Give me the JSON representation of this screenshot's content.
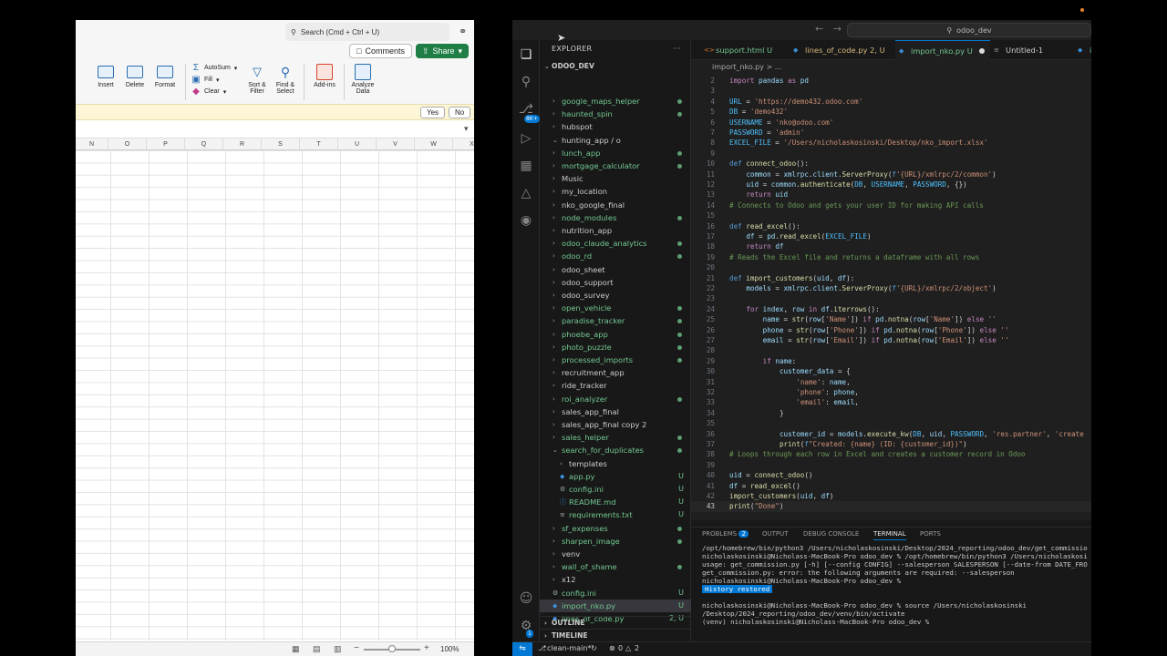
{
  "excel": {
    "search": "Search (Cmd + Ctrl + U)",
    "comments": "Comments",
    "share": "Share",
    "ribbon": {
      "insert": "Insert",
      "delete": "Delete",
      "format": "Format",
      "autosum": "AutoSum",
      "fill": "Fill",
      "clear": "Clear",
      "sort1": "Sort &",
      "sort2": "Filter",
      "find1": "Find &",
      "find2": "Select",
      "addins": "Add-ins",
      "analyze1": "Analyze",
      "analyze2": "Data"
    },
    "banner": {
      "yes": "Yes",
      "no": "No"
    },
    "columns": [
      "N",
      "O",
      "P",
      "Q",
      "R",
      "S",
      "T",
      "U",
      "V",
      "W",
      "X"
    ],
    "zoom": "100%"
  },
  "vscode": {
    "command_center": "odoo_dev",
    "explorer_title": "EXPLORER",
    "root_folder": "ODOO_DEV",
    "scm_badge": "8K+",
    "settings_badge": "1",
    "tree": [
      {
        "label": "google_maps_helper",
        "stat": "dot",
        "color": "#73c991",
        "depth": 1,
        "type": "folder"
      },
      {
        "label": "haunted_spin",
        "stat": "dot",
        "color": "#73c991",
        "depth": 1,
        "type": "folder"
      },
      {
        "label": "hubspot",
        "stat": "",
        "color": "#cccccc",
        "depth": 1,
        "type": "folder"
      },
      {
        "label": "hunting_app / o",
        "stat": "",
        "color": "#cccccc",
        "depth": 1,
        "type": "open"
      },
      {
        "label": "lunch_app",
        "stat": "dot",
        "color": "#73c991",
        "depth": 1,
        "type": "folder"
      },
      {
        "label": "mortgage_calculator",
        "stat": "dot",
        "color": "#73c991",
        "depth": 1,
        "type": "folder"
      },
      {
        "label": "Music",
        "stat": "",
        "color": "#cccccc",
        "depth": 1,
        "type": "folder"
      },
      {
        "label": "my_location",
        "stat": "",
        "color": "#cccccc",
        "depth": 1,
        "type": "folder"
      },
      {
        "label": "nko_google_final",
        "stat": "",
        "color": "#cccccc",
        "depth": 1,
        "type": "folder"
      },
      {
        "label": "node_modules",
        "stat": "dot",
        "color": "#73c991",
        "depth": 1,
        "type": "folder"
      },
      {
        "label": "nutrition_app",
        "stat": "",
        "color": "#cccccc",
        "depth": 1,
        "type": "folder"
      },
      {
        "label": "odoo_claude_analytics",
        "stat": "dot",
        "color": "#73c991",
        "depth": 1,
        "type": "folder"
      },
      {
        "label": "odoo_rd",
        "stat": "dot",
        "color": "#73c991",
        "depth": 1,
        "type": "folder"
      },
      {
        "label": "odoo_sheet",
        "stat": "",
        "color": "#cccccc",
        "depth": 1,
        "type": "folder"
      },
      {
        "label": "odoo_support",
        "stat": "",
        "color": "#cccccc",
        "depth": 1,
        "type": "folder"
      },
      {
        "label": "odoo_survey",
        "stat": "",
        "color": "#cccccc",
        "depth": 1,
        "type": "folder"
      },
      {
        "label": "open_vehicle",
        "stat": "dot",
        "color": "#73c991",
        "depth": 1,
        "type": "folder"
      },
      {
        "label": "paradise_tracker",
        "stat": "dot",
        "color": "#73c991",
        "depth": 1,
        "type": "folder"
      },
      {
        "label": "phoebe_app",
        "stat": "dot",
        "color": "#73c991",
        "depth": 1,
        "type": "folder"
      },
      {
        "label": "photo_puzzle",
        "stat": "dot",
        "color": "#73c991",
        "depth": 1,
        "type": "folder"
      },
      {
        "label": "processed_imports",
        "stat": "dot",
        "color": "#73c991",
        "depth": 1,
        "type": "folder"
      },
      {
        "label": "recruitment_app",
        "stat": "",
        "color": "#cccccc",
        "depth": 1,
        "type": "folder"
      },
      {
        "label": "ride_tracker",
        "stat": "",
        "color": "#cccccc",
        "depth": 1,
        "type": "folder"
      },
      {
        "label": "roi_analyzer",
        "stat": "dot",
        "color": "#73c991",
        "depth": 1,
        "type": "folder"
      },
      {
        "label": "sales_app_final",
        "stat": "",
        "color": "#cccccc",
        "depth": 1,
        "type": "folder"
      },
      {
        "label": "sales_app_final copy 2",
        "stat": "",
        "color": "#cccccc",
        "depth": 1,
        "type": "folder"
      },
      {
        "label": "sales_helper",
        "stat": "dot",
        "color": "#73c991",
        "depth": 1,
        "type": "folder"
      },
      {
        "label": "search_for_duplicates",
        "stat": "dot",
        "color": "#73c991",
        "depth": 1,
        "type": "open"
      },
      {
        "label": "templates",
        "stat": "",
        "color": "#cccccc",
        "depth": 2,
        "type": "folder"
      },
      {
        "label": "app.py",
        "stat": "U",
        "color": "#73c991",
        "depth": 2,
        "type": "py"
      },
      {
        "label": "config.ini",
        "stat": "U",
        "color": "#73c991",
        "depth": 2,
        "type": "ini"
      },
      {
        "label": "README.md",
        "stat": "U",
        "color": "#73c991",
        "depth": 2,
        "type": "info"
      },
      {
        "label": "requirements.txt",
        "stat": "U",
        "color": "#73c991",
        "depth": 2,
        "type": "txt"
      },
      {
        "label": "sf_expenses",
        "stat": "dot",
        "color": "#73c991",
        "depth": 1,
        "type": "folder"
      },
      {
        "label": "sharpen_image",
        "stat": "dot",
        "color": "#73c991",
        "depth": 1,
        "type": "folder"
      },
      {
        "label": "venv",
        "stat": "",
        "color": "#cccccc",
        "depth": 1,
        "type": "folder"
      },
      {
        "label": "wall_of_shame",
        "stat": "dot",
        "color": "#73c991",
        "depth": 1,
        "type": "folder"
      },
      {
        "label": "x12",
        "stat": "",
        "color": "#cccccc",
        "depth": 1,
        "type": "folder"
      },
      {
        "label": "config.ini",
        "stat": "U",
        "color": "#73c991",
        "depth": 0,
        "type": "ini"
      },
      {
        "label": "import_nko.py",
        "stat": "U",
        "color": "#73c991",
        "depth": 0,
        "type": "py",
        "selected": true
      },
      {
        "label": "lines_of_code.py",
        "stat": "2, U",
        "color": "#73c991",
        "depth": 0,
        "type": "py"
      }
    ],
    "outline": "OUTLINE",
    "timeline": "TIMELINE",
    "tabs": [
      {
        "label": "support.html U",
        "icon": "<>",
        "color": "#73c991",
        "active": false
      },
      {
        "label": "lines_of_code.py 2, U",
        "icon": "py",
        "color": "#d7ba7d",
        "active": false
      },
      {
        "label": "import_nko.py U",
        "icon": "py",
        "color": "#73c991",
        "active": true
      },
      {
        "label": "Untitled-1",
        "icon": "=",
        "color": "#cccccc",
        "active": false
      },
      {
        "label": "i",
        "icon": "py",
        "color": "#73c991",
        "active": false
      }
    ],
    "breadcrumb": "import_nko.py > ...",
    "code": [
      {
        "n": "2",
        "t": "import pandas as pd"
      },
      {
        "n": "3",
        "t": ""
      },
      {
        "n": "4",
        "t": "URL = 'https://demo432.odoo.com'"
      },
      {
        "n": "5",
        "t": "DB = 'demo432'"
      },
      {
        "n": "6",
        "t": "USERNAME = 'nko@odoo.com'"
      },
      {
        "n": "7",
        "t": "PASSWORD = 'admin'"
      },
      {
        "n": "8",
        "t": "EXCEL_FILE = '/Users/nicholaskosinski/Desktop/nko_import.xlsx'"
      },
      {
        "n": "9",
        "t": ""
      },
      {
        "n": "10",
        "t": "def connect_odoo():"
      },
      {
        "n": "11",
        "t": "    common = xmlrpc.client.ServerProxy(f'{URL}/xmlrpc/2/common')"
      },
      {
        "n": "12",
        "t": "    uid = common.authenticate(DB, USERNAME, PASSWORD, {})"
      },
      {
        "n": "13",
        "t": "    return uid"
      },
      {
        "n": "14",
        "t": "# Connects to Odoo and gets your user ID for making API calls"
      },
      {
        "n": "15",
        "t": ""
      },
      {
        "n": "16",
        "t": "def read_excel():"
      },
      {
        "n": "17",
        "t": "    df = pd.read_excel(EXCEL_FILE)"
      },
      {
        "n": "18",
        "t": "    return df"
      },
      {
        "n": "19",
        "t": "# Reads the Excel file and returns a dataframe with all rows"
      },
      {
        "n": "20",
        "t": ""
      },
      {
        "n": "21",
        "t": "def import_customers(uid, df):"
      },
      {
        "n": "22",
        "t": "    models = xmlrpc.client.ServerProxy(f'{URL}/xmlrpc/2/object')"
      },
      {
        "n": "23",
        "t": ""
      },
      {
        "n": "24",
        "t": "    for index, row in df.iterrows():"
      },
      {
        "n": "25",
        "t": "        name = str(row['Name']) if pd.notna(row['Name']) else ''"
      },
      {
        "n": "26",
        "t": "        phone = str(row['Phone']) if pd.notna(row['Phone']) else ''"
      },
      {
        "n": "27",
        "t": "        email = str(row['Email']) if pd.notna(row['Email']) else ''"
      },
      {
        "n": "28",
        "t": ""
      },
      {
        "n": "29",
        "t": "        if name:"
      },
      {
        "n": "30",
        "t": "            customer_data = {"
      },
      {
        "n": "31",
        "t": "                'name': name,"
      },
      {
        "n": "32",
        "t": "                'phone': phone,"
      },
      {
        "n": "33",
        "t": "                'email': email,"
      },
      {
        "n": "34",
        "t": "            }"
      },
      {
        "n": "35",
        "t": ""
      },
      {
        "n": "36",
        "t": "            customer_id = models.execute_kw(DB, uid, PASSWORD, 'res.partner', 'create"
      },
      {
        "n": "37",
        "t": "            print(f\"Created: {name} (ID: {customer_id})\")"
      },
      {
        "n": "38",
        "t": "# Loops through each row in Excel and creates a customer record in Odoo"
      },
      {
        "n": "39",
        "t": ""
      },
      {
        "n": "40",
        "t": "uid = connect_odoo()"
      },
      {
        "n": "41",
        "t": "df = read_excel()"
      },
      {
        "n": "42",
        "t": "import_customers(uid, df)"
      },
      {
        "n": "43",
        "t": "print(\"Done\")"
      }
    ],
    "panel_tabs": {
      "problems": "PROBLEMS",
      "problems_count": "2",
      "output": "OUTPUT",
      "debug": "DEBUG CONSOLE",
      "terminal": "TERMINAL",
      "ports": "PORTS"
    },
    "terminal": [
      "/opt/homebrew/bin/python3 /Users/nicholaskosinski/Desktop/2024_reporting/odoo_dev/get_commissio",
      "nicholaskosinski@Nicholass-MacBook-Pro odoo_dev % /opt/homebrew/bin/python3 /Users/nicholaskosi",
      "usage: get_commission.py [-h] [--config CONFIG] --salesperson SALESPERSON [--date-from DATE_FRO",
      "get_commission.py: error: the following arguments are required: --salesperson",
      "nicholaskosinski@Nicholass-MacBook-Pro odoo_dev %",
      "",
      "",
      "nicholaskosinski@Nicholass-MacBook-Pro odoo_dev % source /Users/nicholaskosinski",
      "/Desktop/2024_reporting/odoo_dev/venv/bin/activate",
      "(venv) nicholaskosinski@Nicholass-MacBook-Pro odoo_dev %"
    ],
    "history_restored": "History restored",
    "status": {
      "branch": "clean-main*",
      "errors": "0",
      "warnings": "2"
    }
  }
}
